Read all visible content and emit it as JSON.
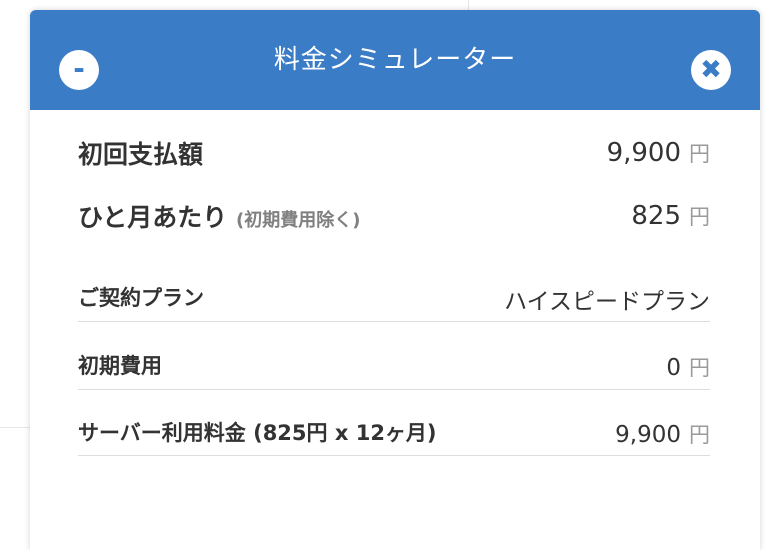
{
  "dialog": {
    "title": "料金シミュレーター",
    "minimize_icon": "minus-icon",
    "minimize_glyph": "-",
    "close_icon": "close-icon",
    "close_glyph": "✖"
  },
  "summary": [
    {
      "label": "初回支払額",
      "note": "",
      "value": "9,900",
      "unit": "円"
    },
    {
      "label": "ひと月あたり",
      "note": "(初期費用除く)",
      "value": "825",
      "unit": "円"
    }
  ],
  "details": [
    {
      "label": "ご契約プラン",
      "value": "ハイスピードプラン",
      "unit": ""
    },
    {
      "label": "初期費用",
      "value": "0",
      "unit": "円"
    },
    {
      "label": "サーバー利用料金 (825円 x 12ヶ月)",
      "value": "9,900",
      "unit": "円"
    }
  ],
  "colors": {
    "header": "#3a7cc6",
    "text": "#333333",
    "muted": "#808080"
  }
}
